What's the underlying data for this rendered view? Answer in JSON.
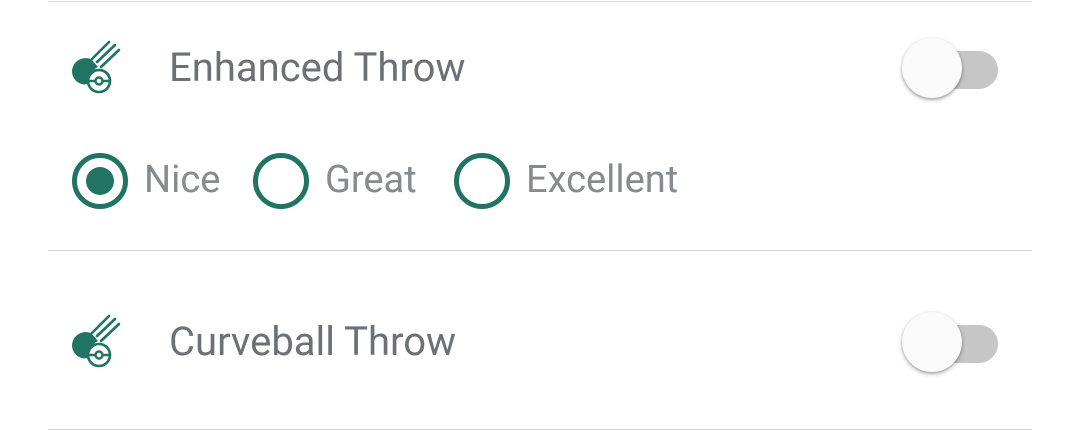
{
  "accent_color": "#217364",
  "settings": [
    {
      "icon": "pokeball-throw-icon",
      "label": "Enhanced Throw",
      "enabled": false
    },
    {
      "icon": "pokeball-throw-icon",
      "label": "Curveball Throw",
      "enabled": false
    }
  ],
  "throw_quality": {
    "options": [
      "Nice",
      "Great",
      "Excellent"
    ],
    "selected": "Nice"
  }
}
